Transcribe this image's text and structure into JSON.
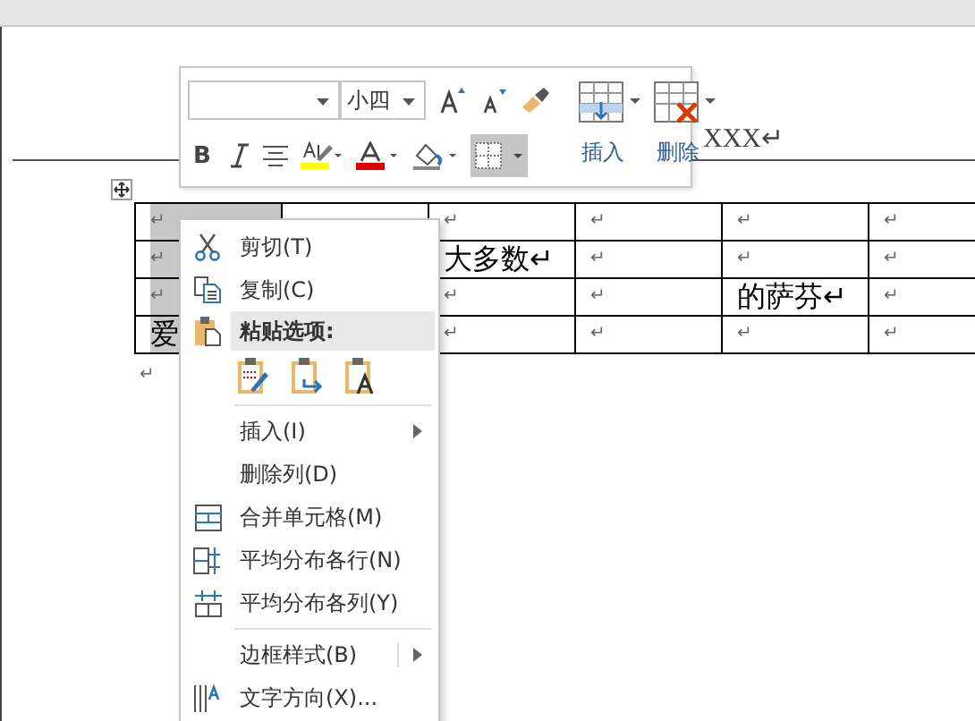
{
  "document": {
    "header_text": "XXX↵",
    "table": {
      "rows": [
        {
          "cells": [
            {
              "text": "↵",
              "selected": true
            },
            {},
            {
              "text": "↵",
              "selected": false
            },
            {
              "text": "↵",
              "selected": false
            },
            {
              "text": "↵",
              "selected": false
            },
            {
              "text": "↵",
              "selected": false
            }
          ]
        },
        {
          "cells": [
            {
              "text": "↵",
              "selected": true
            },
            {},
            {
              "text": "大多数↵",
              "selected": false
            },
            {
              "text": "↵",
              "selected": false
            },
            {
              "text": "↵",
              "selected": false
            },
            {
              "text": "↵",
              "selected": false
            }
          ]
        },
        {
          "cells": [
            {
              "text": "↵",
              "selected": true
            },
            {},
            {
              "text": "↵",
              "selected": false
            },
            {
              "text": "↵",
              "selected": false
            },
            {
              "text": "的萨芬↵",
              "selected": false
            },
            {
              "text": "↵",
              "selected": false
            }
          ]
        },
        {
          "cells": [
            {
              "text": "爱",
              "selected": true
            },
            {},
            {
              "text": "↵",
              "selected": false
            },
            {
              "text": "↵",
              "selected": false
            },
            {
              "text": "↵",
              "selected": false
            },
            {
              "text": "↵",
              "selected": false
            }
          ]
        }
      ]
    },
    "end_mark": "↵"
  },
  "mini_toolbar": {
    "font_size": "小四",
    "bold_label": "B",
    "borders_button": {
      "selected": true
    },
    "insert_label": "插入",
    "delete_label": "删除"
  },
  "context_menu": {
    "items": [
      {
        "kind": "command",
        "label": "剪切(T)"
      },
      {
        "kind": "command",
        "label": "复制(C)"
      },
      {
        "kind": "header",
        "label": "粘贴选项:"
      },
      {
        "kind": "paste_options"
      },
      {
        "kind": "separator"
      },
      {
        "kind": "submenu",
        "label": "插入(I)"
      },
      {
        "kind": "command",
        "label": "删除列(D)"
      },
      {
        "kind": "command",
        "label": "合并单元格(M)"
      },
      {
        "kind": "command",
        "label": "平均分布各行(N)"
      },
      {
        "kind": "command",
        "label": "平均分布各列(Y)"
      },
      {
        "kind": "separator"
      },
      {
        "kind": "submenu",
        "label": "边框样式(B)"
      },
      {
        "kind": "command",
        "label": "文字方向(X)..."
      }
    ]
  }
}
